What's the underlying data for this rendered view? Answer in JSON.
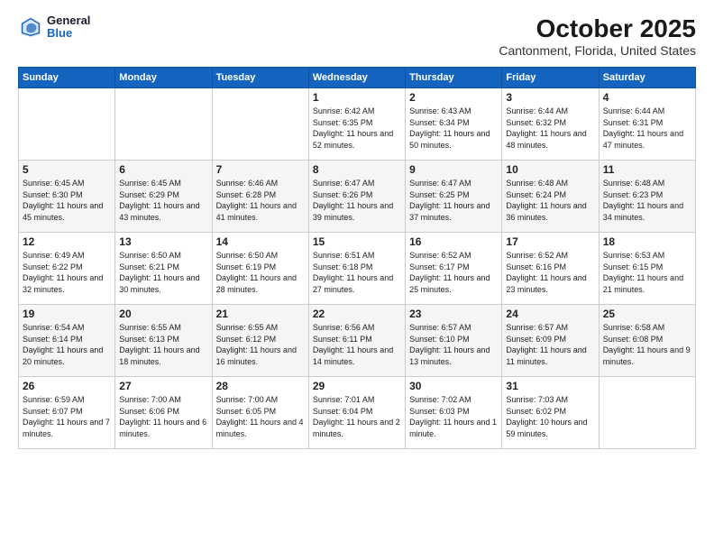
{
  "header": {
    "logo_general": "General",
    "logo_blue": "Blue",
    "title": "October 2025",
    "subtitle": "Cantonment, Florida, United States"
  },
  "weekdays": [
    "Sunday",
    "Monday",
    "Tuesday",
    "Wednesday",
    "Thursday",
    "Friday",
    "Saturday"
  ],
  "weeks": [
    [
      {
        "day": "",
        "info": ""
      },
      {
        "day": "",
        "info": ""
      },
      {
        "day": "",
        "info": ""
      },
      {
        "day": "1",
        "info": "Sunrise: 6:42 AM\nSunset: 6:35 PM\nDaylight: 11 hours and 52 minutes."
      },
      {
        "day": "2",
        "info": "Sunrise: 6:43 AM\nSunset: 6:34 PM\nDaylight: 11 hours and 50 minutes."
      },
      {
        "day": "3",
        "info": "Sunrise: 6:44 AM\nSunset: 6:32 PM\nDaylight: 11 hours and 48 minutes."
      },
      {
        "day": "4",
        "info": "Sunrise: 6:44 AM\nSunset: 6:31 PM\nDaylight: 11 hours and 47 minutes."
      }
    ],
    [
      {
        "day": "5",
        "info": "Sunrise: 6:45 AM\nSunset: 6:30 PM\nDaylight: 11 hours and 45 minutes."
      },
      {
        "day": "6",
        "info": "Sunrise: 6:45 AM\nSunset: 6:29 PM\nDaylight: 11 hours and 43 minutes."
      },
      {
        "day": "7",
        "info": "Sunrise: 6:46 AM\nSunset: 6:28 PM\nDaylight: 11 hours and 41 minutes."
      },
      {
        "day": "8",
        "info": "Sunrise: 6:47 AM\nSunset: 6:26 PM\nDaylight: 11 hours and 39 minutes."
      },
      {
        "day": "9",
        "info": "Sunrise: 6:47 AM\nSunset: 6:25 PM\nDaylight: 11 hours and 37 minutes."
      },
      {
        "day": "10",
        "info": "Sunrise: 6:48 AM\nSunset: 6:24 PM\nDaylight: 11 hours and 36 minutes."
      },
      {
        "day": "11",
        "info": "Sunrise: 6:48 AM\nSunset: 6:23 PM\nDaylight: 11 hours and 34 minutes."
      }
    ],
    [
      {
        "day": "12",
        "info": "Sunrise: 6:49 AM\nSunset: 6:22 PM\nDaylight: 11 hours and 32 minutes."
      },
      {
        "day": "13",
        "info": "Sunrise: 6:50 AM\nSunset: 6:21 PM\nDaylight: 11 hours and 30 minutes."
      },
      {
        "day": "14",
        "info": "Sunrise: 6:50 AM\nSunset: 6:19 PM\nDaylight: 11 hours and 28 minutes."
      },
      {
        "day": "15",
        "info": "Sunrise: 6:51 AM\nSunset: 6:18 PM\nDaylight: 11 hours and 27 minutes."
      },
      {
        "day": "16",
        "info": "Sunrise: 6:52 AM\nSunset: 6:17 PM\nDaylight: 11 hours and 25 minutes."
      },
      {
        "day": "17",
        "info": "Sunrise: 6:52 AM\nSunset: 6:16 PM\nDaylight: 11 hours and 23 minutes."
      },
      {
        "day": "18",
        "info": "Sunrise: 6:53 AM\nSunset: 6:15 PM\nDaylight: 11 hours and 21 minutes."
      }
    ],
    [
      {
        "day": "19",
        "info": "Sunrise: 6:54 AM\nSunset: 6:14 PM\nDaylight: 11 hours and 20 minutes."
      },
      {
        "day": "20",
        "info": "Sunrise: 6:55 AM\nSunset: 6:13 PM\nDaylight: 11 hours and 18 minutes."
      },
      {
        "day": "21",
        "info": "Sunrise: 6:55 AM\nSunset: 6:12 PM\nDaylight: 11 hours and 16 minutes."
      },
      {
        "day": "22",
        "info": "Sunrise: 6:56 AM\nSunset: 6:11 PM\nDaylight: 11 hours and 14 minutes."
      },
      {
        "day": "23",
        "info": "Sunrise: 6:57 AM\nSunset: 6:10 PM\nDaylight: 11 hours and 13 minutes."
      },
      {
        "day": "24",
        "info": "Sunrise: 6:57 AM\nSunset: 6:09 PM\nDaylight: 11 hours and 11 minutes."
      },
      {
        "day": "25",
        "info": "Sunrise: 6:58 AM\nSunset: 6:08 PM\nDaylight: 11 hours and 9 minutes."
      }
    ],
    [
      {
        "day": "26",
        "info": "Sunrise: 6:59 AM\nSunset: 6:07 PM\nDaylight: 11 hours and 7 minutes."
      },
      {
        "day": "27",
        "info": "Sunrise: 7:00 AM\nSunset: 6:06 PM\nDaylight: 11 hours and 6 minutes."
      },
      {
        "day": "28",
        "info": "Sunrise: 7:00 AM\nSunset: 6:05 PM\nDaylight: 11 hours and 4 minutes."
      },
      {
        "day": "29",
        "info": "Sunrise: 7:01 AM\nSunset: 6:04 PM\nDaylight: 11 hours and 2 minutes."
      },
      {
        "day": "30",
        "info": "Sunrise: 7:02 AM\nSunset: 6:03 PM\nDaylight: 11 hours and 1 minute."
      },
      {
        "day": "31",
        "info": "Sunrise: 7:03 AM\nSunset: 6:02 PM\nDaylight: 10 hours and 59 minutes."
      },
      {
        "day": "",
        "info": ""
      }
    ]
  ]
}
